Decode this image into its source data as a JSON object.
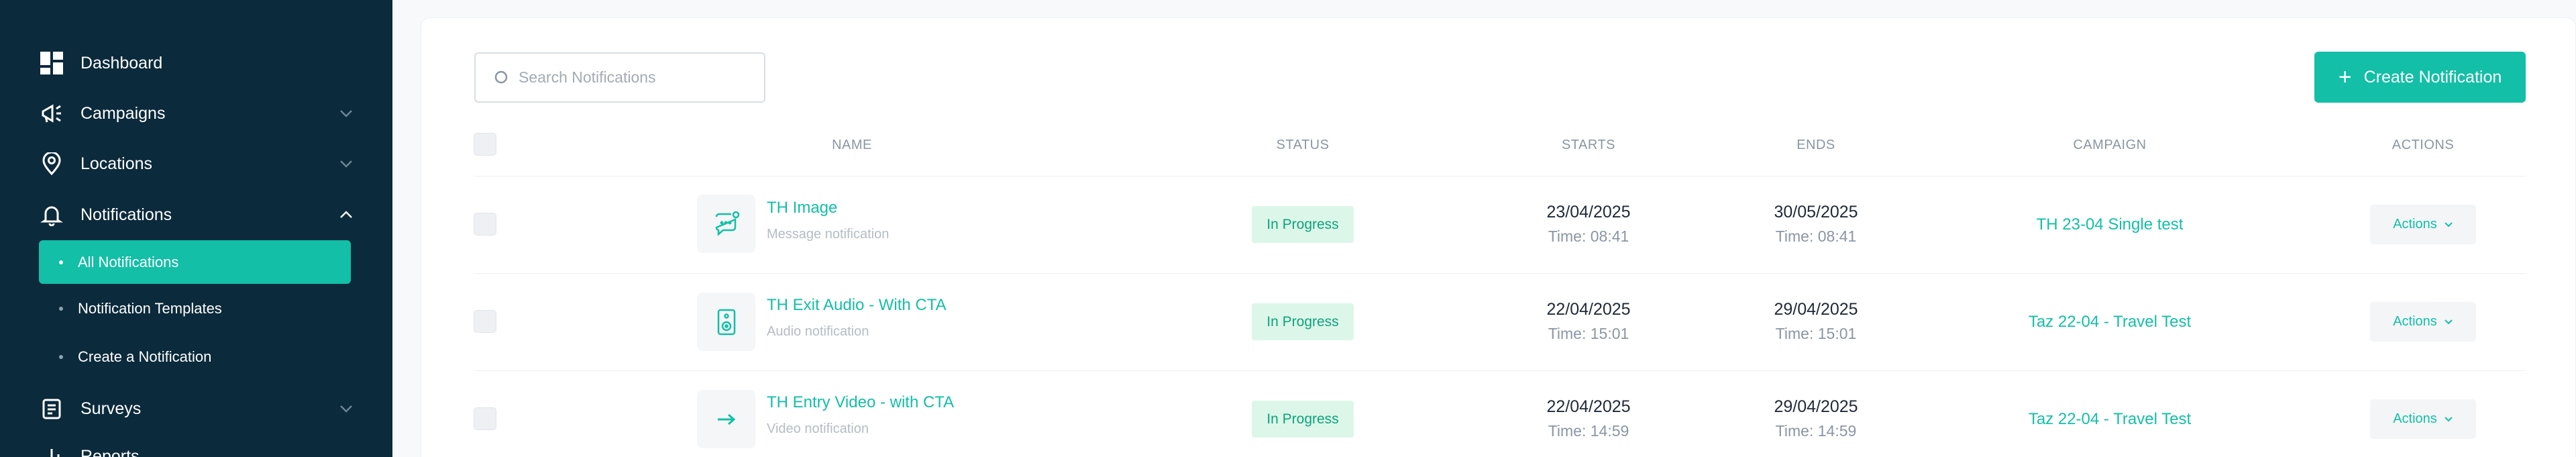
{
  "sidebar": {
    "items": [
      {
        "label": "Dashboard",
        "icon": "dashboard-icon"
      },
      {
        "label": "Campaigns",
        "icon": "megaphone-icon"
      },
      {
        "label": "Locations",
        "icon": "location-pin-icon"
      },
      {
        "label": "Notifications",
        "icon": "bell-icon"
      },
      {
        "label": "Surveys",
        "icon": "survey-icon"
      },
      {
        "label": "Reports",
        "icon": "report-icon"
      }
    ],
    "notifications_sub": [
      {
        "label": "All Notifications"
      },
      {
        "label": "Notification Templates"
      },
      {
        "label": "Create a Notification"
      }
    ]
  },
  "search": {
    "placeholder": "Search Notifications"
  },
  "create_button": {
    "label": "Create Notification"
  },
  "table": {
    "headers": [
      "NAME",
      "STATUS",
      "STARTS",
      "ENDS",
      "CAMPAIGN",
      "ACTIONS"
    ],
    "rows": [
      {
        "title": "TH Image",
        "subtitle": "Message notification",
        "thumb_icon": "message-icon",
        "status": "In Progress",
        "start_date": "23/04/2025",
        "start_time": "Time: 08:41",
        "end_date": "30/05/2025",
        "end_time": "Time: 08:41",
        "campaign": "TH 23-04 Single test",
        "actions": "Actions"
      },
      {
        "title": "TH Exit Audio - With CTA",
        "subtitle": "Audio notification",
        "thumb_icon": "speaker-icon",
        "status": "In Progress",
        "start_date": "22/04/2025",
        "start_time": "Time: 15:01",
        "end_date": "29/04/2025",
        "end_time": "Time: 15:01",
        "campaign": "Taz 22-04 - Travel Test",
        "actions": "Actions"
      },
      {
        "title": "TH Entry Video - with CTA",
        "subtitle": "Video notification",
        "thumb_icon": "arrow-right-icon",
        "status": "In Progress",
        "start_date": "22/04/2025",
        "start_time": "Time: 14:59",
        "end_date": "29/04/2025",
        "end_time": "Time: 14:59",
        "campaign": "Taz 22-04 - Travel Test",
        "actions": "Actions"
      }
    ]
  },
  "colors": {
    "accent": "#13bfa6",
    "sidebar_bg": "#0b2a3b",
    "badge_bg": "#dcf7ea",
    "badge_text": "#0ea37a"
  }
}
